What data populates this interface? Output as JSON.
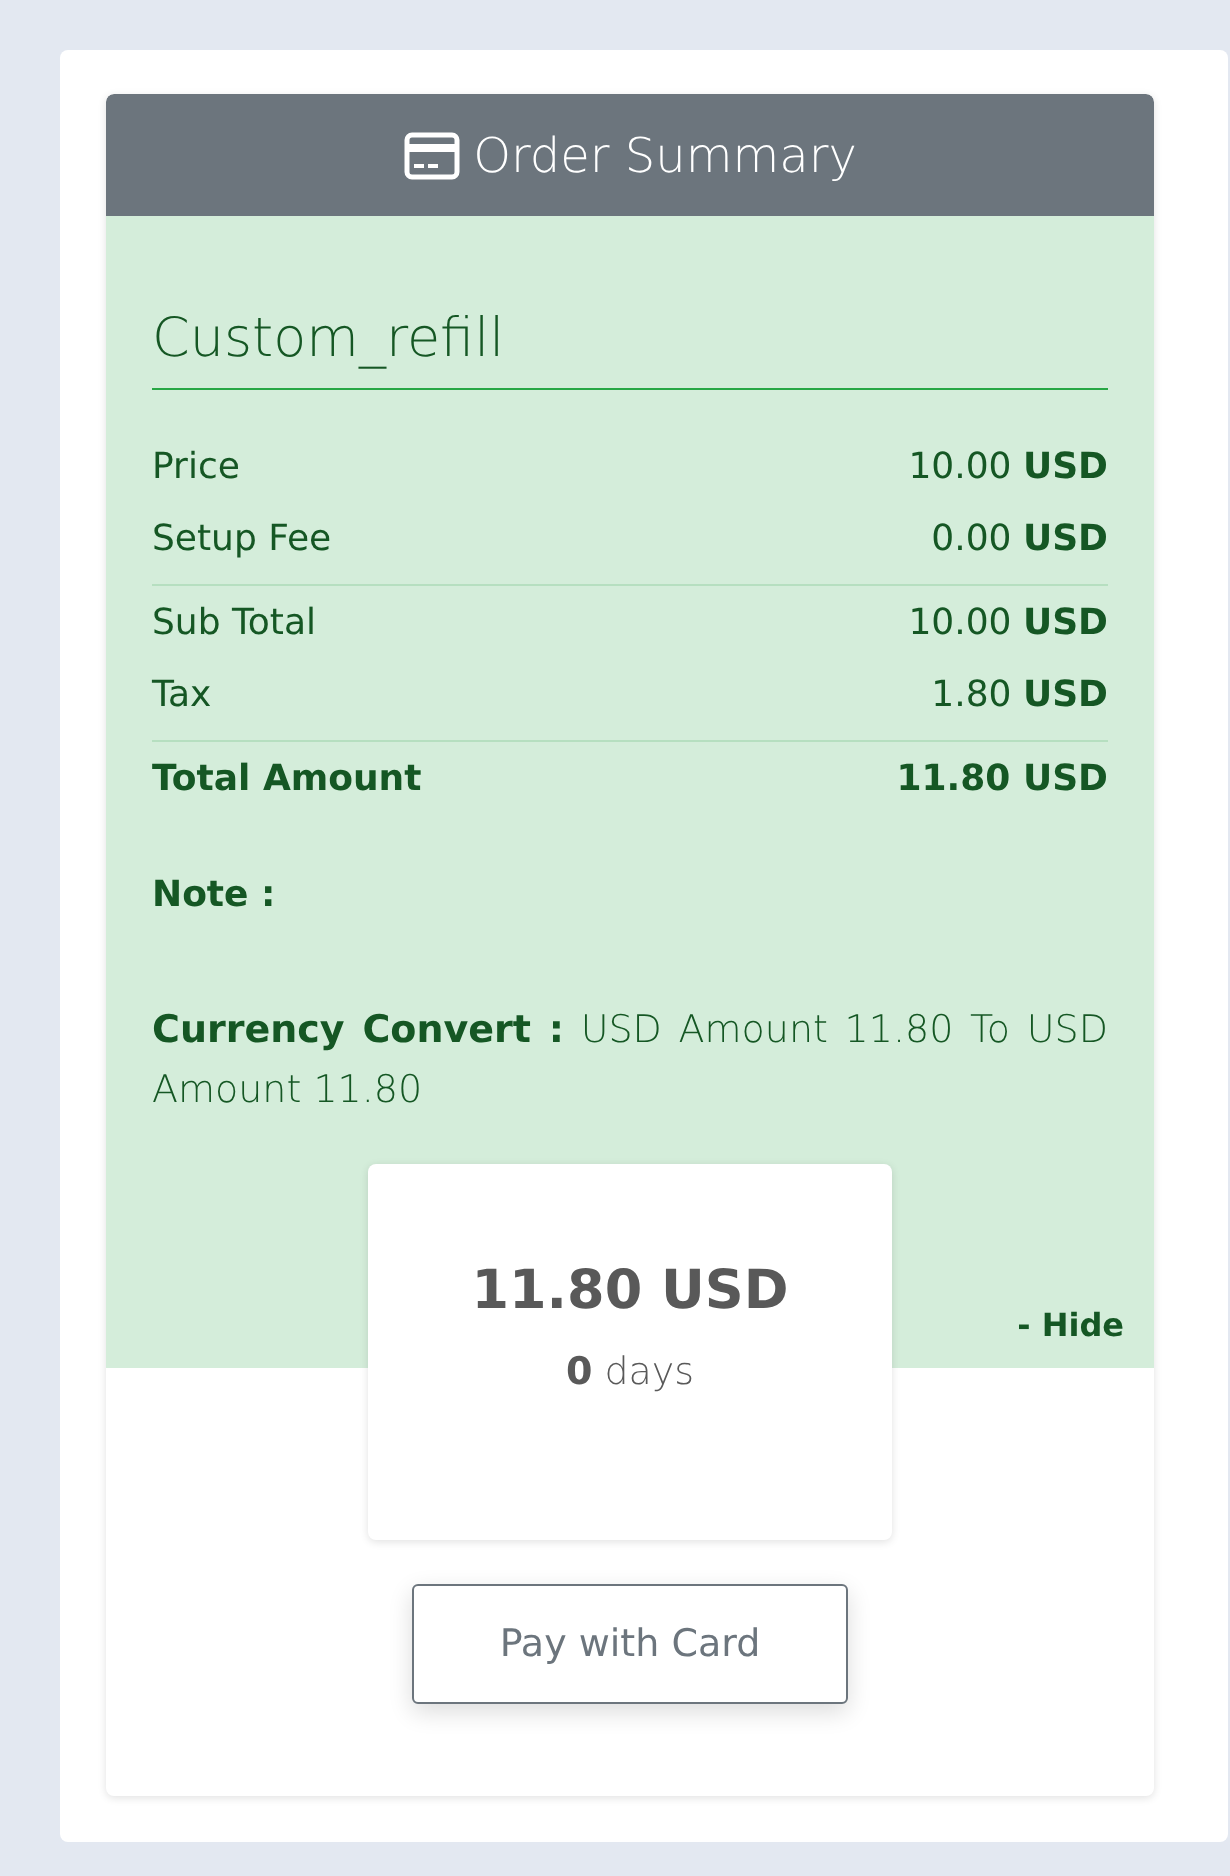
{
  "header": {
    "title": "Order Summary"
  },
  "product": {
    "name": "Custom_refill"
  },
  "line_groups": [
    [
      {
        "kind": "line",
        "label": "Price",
        "amount": "10.00",
        "currency": "USD"
      },
      {
        "kind": "line",
        "label": "Setup Fee",
        "amount": "0.00",
        "currency": "USD"
      }
    ],
    [
      {
        "kind": "line",
        "label": "Sub Total",
        "amount": "10.00",
        "currency": "USD"
      },
      {
        "kind": "line",
        "label": "Tax",
        "amount": "1.80",
        "currency": "USD"
      }
    ],
    [
      {
        "kind": "total",
        "label": "Total Amount",
        "amount": "11.80",
        "currency": "USD"
      }
    ]
  ],
  "note": {
    "label": "Note :"
  },
  "currency_convert": "**Currency Convert :** USD Amount 11.80 To USD Amount 11.80",
  "hide_link": "- Hide",
  "price_box": {
    "amount": "11.80 USD",
    "period": "**0** days"
  },
  "pay_button": "Pay with Card"
}
